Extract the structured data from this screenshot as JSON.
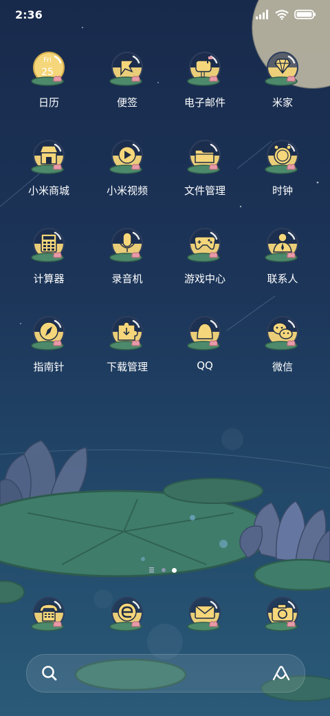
{
  "status_bar": {
    "time": "2:36"
  },
  "colors": {
    "icon_yellow": "#f5d67a",
    "icon_outline": "#1d2b44",
    "lotus_pink": "#e79aa8",
    "lily_green": "#3f7c6a"
  },
  "home_apps": [
    {
      "label": "日历",
      "icon": "calendar-icon",
      "day": "Fri",
      "date": "25"
    },
    {
      "label": "便签",
      "icon": "notes-icon"
    },
    {
      "label": "电子邮件",
      "icon": "mailbox-icon"
    },
    {
      "label": "米家",
      "icon": "diamond-icon"
    },
    {
      "label": "小米商城",
      "icon": "store-icon"
    },
    {
      "label": "小米视频",
      "icon": "video-play-icon"
    },
    {
      "label": "文件管理",
      "icon": "folder-icon"
    },
    {
      "label": "时钟",
      "icon": "clock-icon"
    },
    {
      "label": "计算器",
      "icon": "calculator-icon"
    },
    {
      "label": "录音机",
      "icon": "microphone-icon"
    },
    {
      "label": "游戏中心",
      "icon": "gamepad-icon"
    },
    {
      "label": "联系人",
      "icon": "person-icon"
    },
    {
      "label": "指南针",
      "icon": "compass-icon"
    },
    {
      "label": "下载管理",
      "icon": "puzzle-download-icon"
    },
    {
      "label": "QQ",
      "icon": "qq-bell-icon"
    },
    {
      "label": "微信",
      "icon": "wechat-icon"
    }
  ],
  "page_indicator": {
    "pages": 3,
    "current": 3
  },
  "dock": [
    {
      "icon": "phone-icon"
    },
    {
      "icon": "browser-icon"
    },
    {
      "icon": "messages-icon"
    },
    {
      "icon": "camera-icon"
    }
  ]
}
